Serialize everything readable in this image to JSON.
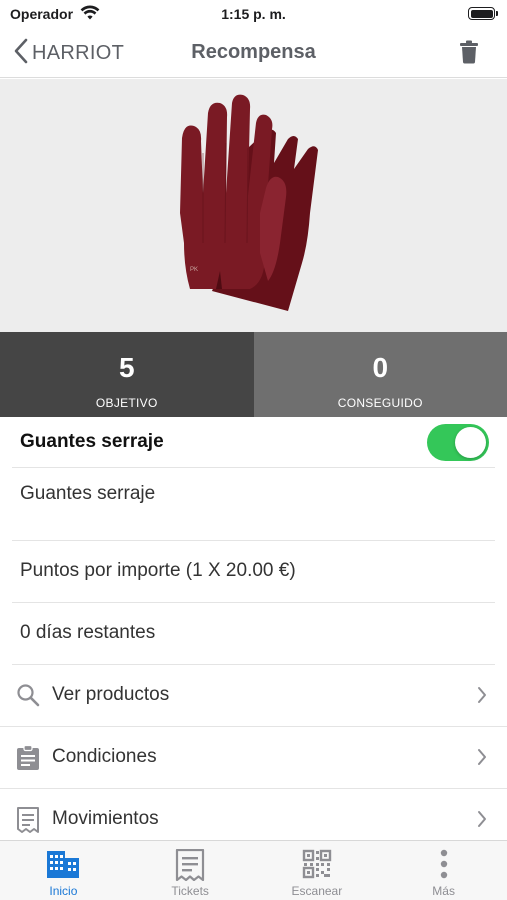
{
  "status_bar": {
    "carrier": "Operador",
    "time": "1:15 p. m."
  },
  "nav": {
    "back_label": "HARRIOT",
    "title": "Recompensa"
  },
  "stats": {
    "objective_value": "5",
    "objective_label": "OBJETIVO",
    "achieved_value": "0",
    "achieved_label": "CONSEGUIDO"
  },
  "reward": {
    "name": "Guantes serraje",
    "enabled": true,
    "description": "Guantes serraje",
    "points_rule": "Puntos por importe (1 X 20.00 €)",
    "days_left": "0 días restantes"
  },
  "links": {
    "products": "Ver productos",
    "conditions": "Condiciones",
    "movements": "Movimientos"
  },
  "tabs": {
    "home": "Inicio",
    "tickets": "Tickets",
    "scan": "Escanear",
    "more": "Más"
  },
  "colors": {
    "accent": "#1a78d6",
    "toggle_on": "#34c759",
    "stat_dark": "#454545",
    "stat_light": "#6f6f6f",
    "glove": "#7a1a24"
  }
}
